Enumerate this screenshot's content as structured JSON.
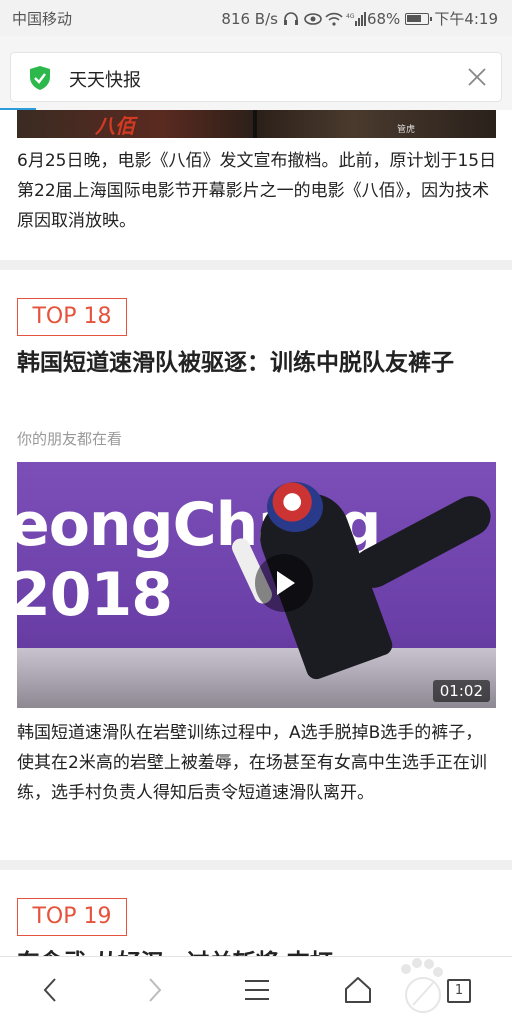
{
  "status_bar": {
    "carrier": "中国移动",
    "speed": "816 B/s",
    "network": "4G",
    "battery": "68%",
    "time": "下午4:19"
  },
  "header": {
    "title": "天天快报",
    "icon": "shield-check-icon",
    "accent": "#2db84b"
  },
  "feed": {
    "prev_item": {
      "image_text": "八佰",
      "image_small_text": "管虎",
      "summary": "6月25日晚，电影《八佰》发文宣布撤档。此前，原计划于15日第22届上海国际电影节开幕影片之一的电影《八佰》，因为技术原因取消放映。"
    },
    "item1": {
      "rank": "TOP 18",
      "title": "韩国短道速滑队被驱逐：训练中脱队友裤子",
      "meta": "你的朋友都在看",
      "video_text": "eongChang 2018",
      "duration": "01:02",
      "summary": "韩国短道速滑队在岩壁训练过程中，A选手脱掉B选手的裤子，使其在2米高的岩壁上被羞辱，在场甚至有女高中生选手正在训练，选手村负责人得知后责令短道速滑队离开。"
    },
    "item2": {
      "rank": "TOP 19",
      "title": "东念武·从好汉，过关斩将 吉打"
    },
    "badge_color": "#e5533d"
  },
  "bottom_nav": {
    "tab_count": "1",
    "icons": [
      "back-icon",
      "forward-icon",
      "menu-icon",
      "home-icon",
      "paw-icon",
      "tabs-icon"
    ]
  }
}
